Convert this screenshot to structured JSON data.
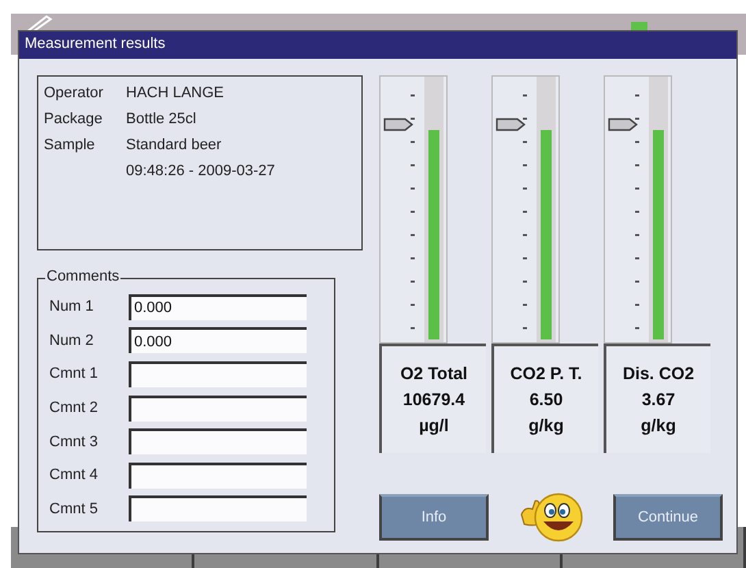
{
  "dialog": {
    "title": "Measurement results",
    "info": [
      {
        "label": "Operator",
        "value": "HACH LANGE"
      },
      {
        "label": "Package",
        "value": "Bottle 25cl"
      },
      {
        "label": "Sample",
        "value": "Standard beer"
      },
      {
        "value": "09:48:26 - 2009-03-27"
      }
    ],
    "comments": {
      "title": "Comments",
      "fields": [
        {
          "label": "Num 1",
          "value": "0.000"
        },
        {
          "label": "Num 2",
          "value": "0.000"
        },
        {
          "label": "Cmnt 1"
        },
        {
          "label": "Cmnt 2"
        },
        {
          "label": "Cmnt 3"
        },
        {
          "label": "Cmnt 4"
        },
        {
          "label": "Cmnt 5"
        }
      ]
    },
    "meters": [
      {
        "name": "O2 Total",
        "value": "10679.4",
        "unit": "µg/l",
        "level": 0.8
      },
      {
        "name": "CO2 P. T.",
        "value": "6.50",
        "unit": "g/kg",
        "level": 0.8
      },
      {
        "name": "Dis. CO2",
        "value": "3.67",
        "unit": "g/kg",
        "level": 0.8
      }
    ],
    "buttons": [
      {
        "label": "Info"
      },
      {
        "label": "Continue"
      }
    ]
  }
}
